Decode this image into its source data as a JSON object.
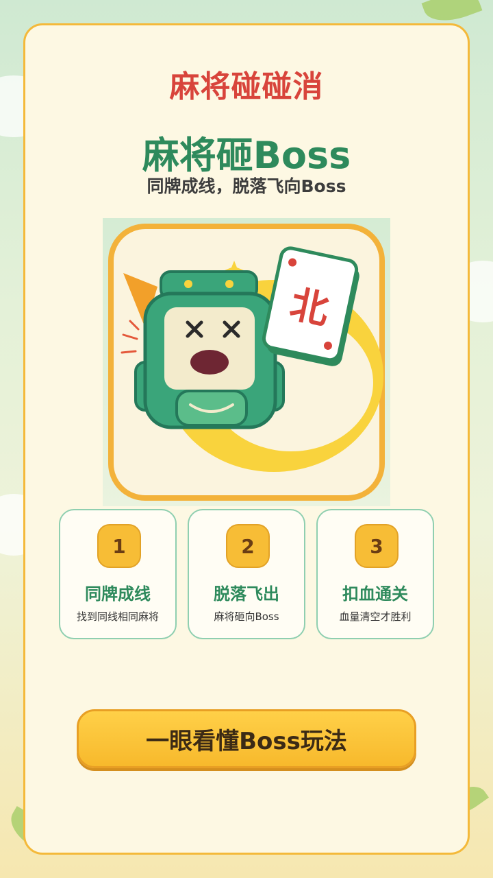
{
  "header": {
    "app_title": "麻将碰碰消"
  },
  "hero": {
    "title": "麻将砸Boss",
    "subtitle": "同牌成线，脱落飞向Boss",
    "tile_char": "北"
  },
  "steps": [
    {
      "number": "1",
      "title": "同牌成线",
      "desc": "找到同线相同麻将"
    },
    {
      "number": "2",
      "title": "脱落飞出",
      "desc": "麻将砸向Boss"
    },
    {
      "number": "3",
      "title": "扣血通关",
      "desc": "血量清空才胜利"
    }
  ],
  "cta": {
    "label": "一眼看懂Boss玩法"
  },
  "colors": {
    "accent_red": "#d8443b",
    "accent_green": "#2e8a5c",
    "button_yellow": "#f7b92c",
    "card_border": "#f4b93a"
  }
}
